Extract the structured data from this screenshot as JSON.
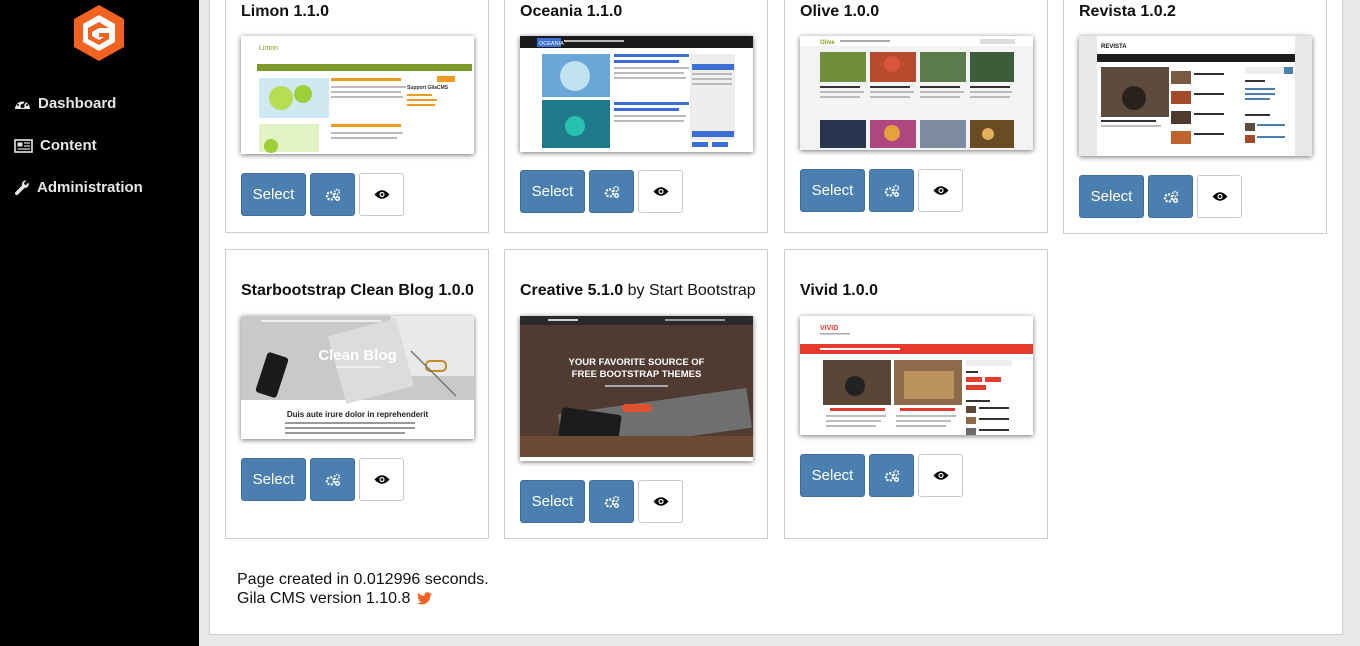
{
  "sidebar": {
    "items": [
      {
        "label": "Dashboard",
        "icon": "dashboard-icon"
      },
      {
        "label": "Content",
        "icon": "newspaper-icon"
      },
      {
        "label": "Administration",
        "icon": "wrench-icon"
      }
    ]
  },
  "themes": [
    {
      "name": "Limon 1.1.0",
      "thumb_text": "Support GilaCMS"
    },
    {
      "name": "Oceania 1.1.0",
      "thumb_text": "OCEANIA"
    },
    {
      "name": "Olive 1.0.0",
      "thumb_text": "Olive"
    },
    {
      "name": "Revista 1.0.2",
      "thumb_text": "REVISTA"
    },
    {
      "name": "Starbootstrap Clean Blog 1.0.0",
      "thumb_text": "Clean Blog",
      "thumb_sub": "Duis aute irure dolor in reprehenderit"
    },
    {
      "name": "Creative 5.1.0",
      "by": "by Start Bootstrap",
      "thumb_text": "YOUR FAVORITE SOURCE OF",
      "thumb_text2": "FREE BOOTSTRAP THEMES"
    },
    {
      "name": "Vivid 1.0.0",
      "thumb_text": "VIVID"
    }
  ],
  "buttons": {
    "select_label": "Select",
    "options_icon": "gears-icon",
    "preview_icon": "eye-icon"
  },
  "footer": {
    "page_created": "Page created in 0.012996 seconds.",
    "version": "Gila CMS version 1.10.8",
    "twitter_icon": "twitter-icon"
  },
  "colors": {
    "accent": "#4a7fb0",
    "logo": "#f26322",
    "sidebar": "#000000"
  }
}
